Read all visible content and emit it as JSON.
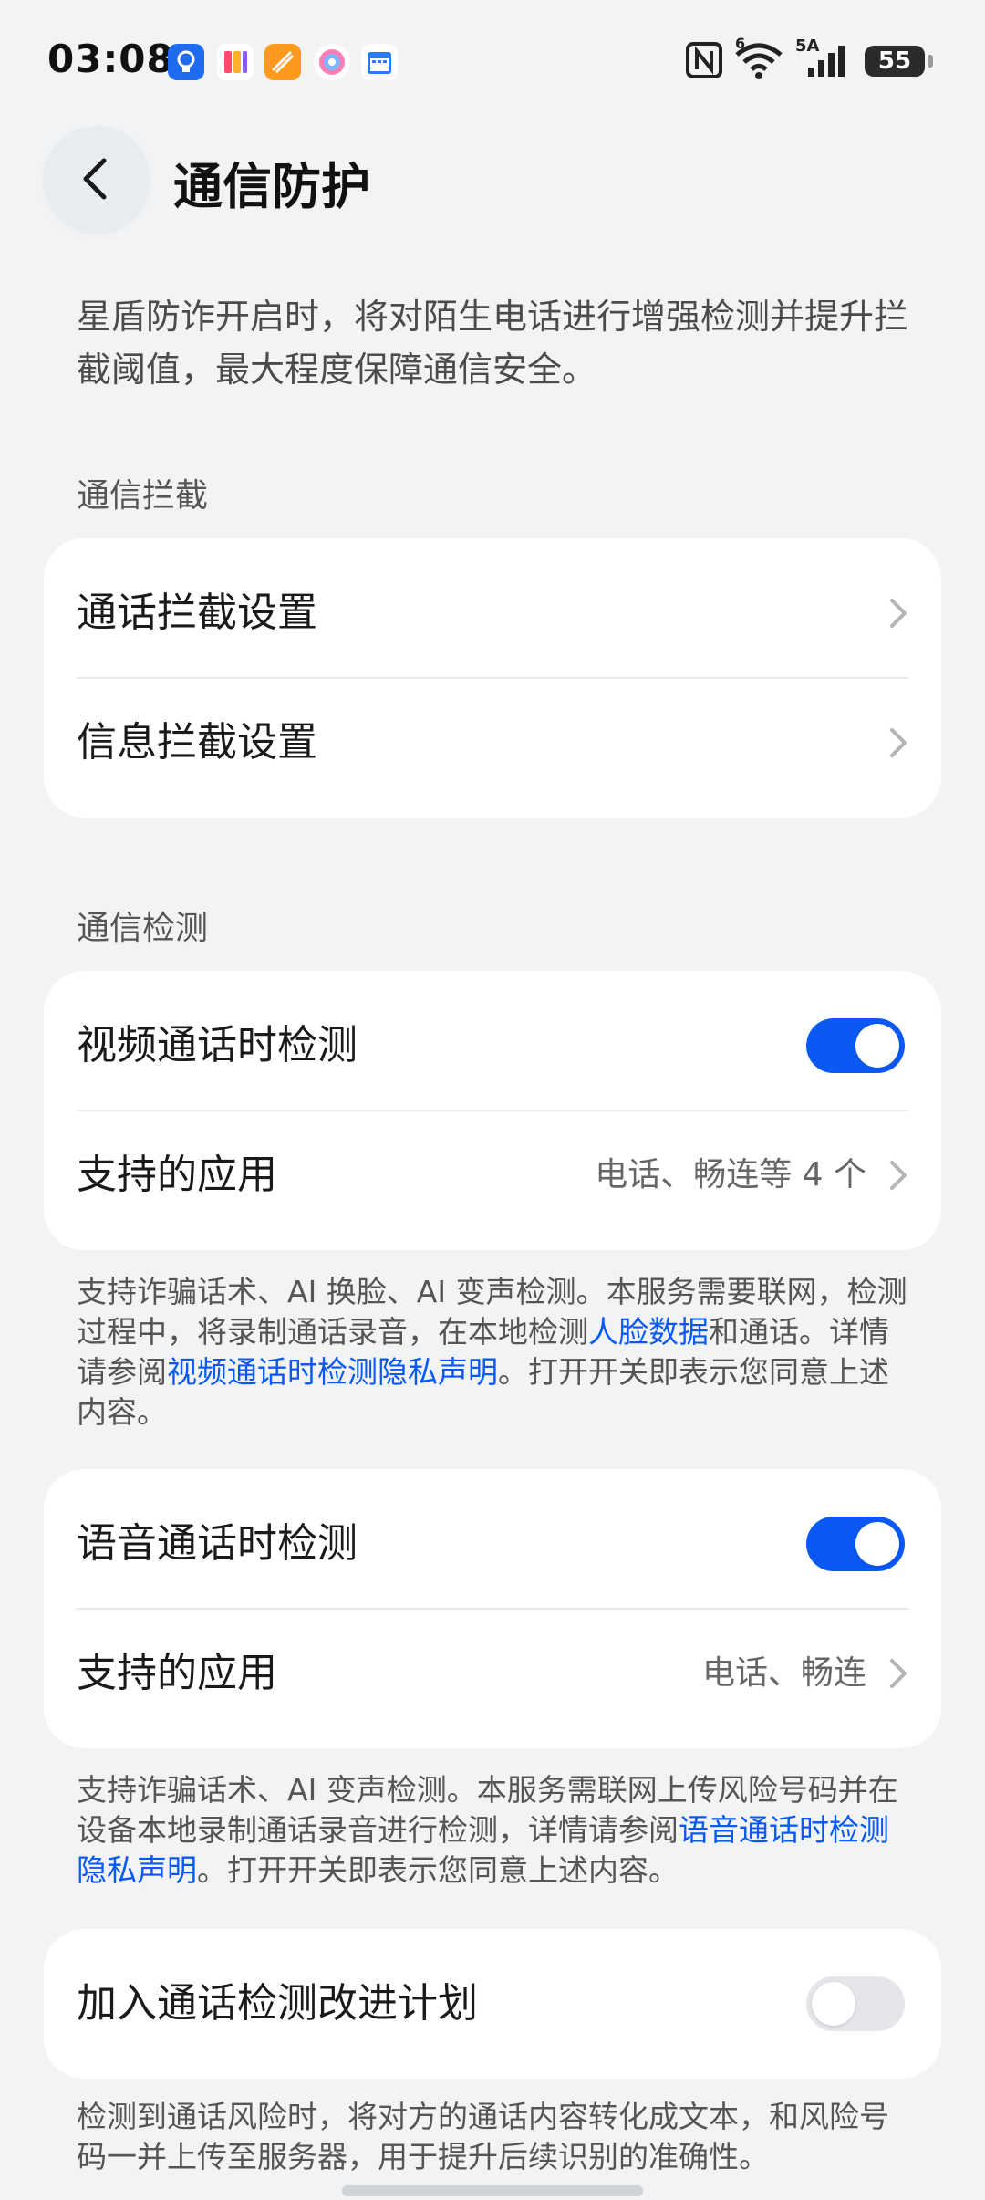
{
  "status_bar": {
    "time": "03:08",
    "battery": "55",
    "network": "5A",
    "wifi_badge": "6"
  },
  "header": {
    "title": "通信防护"
  },
  "intro": "星盾防诈开启时，将对陌生电话进行增强检测并提升拦截阈值，最大程度保障通信安全。",
  "interception": {
    "section_title": "通信拦截",
    "items": [
      {
        "label": "通话拦截设置"
      },
      {
        "label": "信息拦截设置"
      }
    ]
  },
  "detection": {
    "section_title": "通信检测",
    "video": {
      "label": "视频通话时检测",
      "enabled": true,
      "apps_label": "支持的应用",
      "apps_value": "电话、畅连等 4 个",
      "note_parts": [
        "支持诈骗话术、AI 换脸、AI 变声检测。本服务需要联网，检测过程中，将录制通话录音，在本地检测",
        "人脸数据",
        "和通话。详情请参阅",
        "视频通话时检测隐私声明",
        "。打开开关即表示您同意上述内容。"
      ]
    },
    "voice": {
      "label": "语音通话时检测",
      "enabled": true,
      "apps_label": "支持的应用",
      "apps_value": "电话、畅连",
      "note_parts": [
        "支持诈骗话术、AI 变声检测。本服务需联网上传风险号码并在设备本地录制通话录音进行检测，详情请参阅",
        "语音通话时检测隐私声明",
        "。打开开关即表示您同意上述内容。"
      ]
    },
    "improvement": {
      "label": "加入通话检测改进计划",
      "enabled": false,
      "note": "检测到通话风险时，将对方的通话内容转化成文本，和风险号码一并上传至服务器，用于提升后续识别的准确性。"
    }
  },
  "colors": {
    "accent": "#0a59f7",
    "background": "#f1f3f5",
    "card": "#ffffff"
  }
}
